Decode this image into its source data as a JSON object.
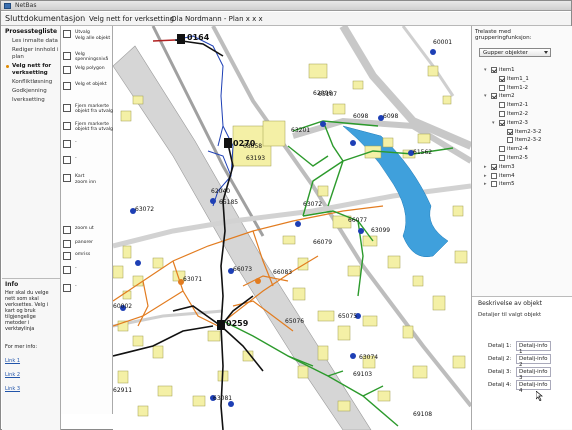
{
  "app": {
    "title": "NetBas"
  },
  "header": {
    "title": "Sluttdokumentasjon",
    "step": "Velg nett for verksetting",
    "context": "Ola Nordmann - Plan x x x"
  },
  "process": {
    "heading": "Prosesstegliste",
    "steps": [
      {
        "label": "Les inmalte data"
      },
      {
        "label": "Rediger innhold i plan"
      },
      {
        "label": "Velg nett for verksetting",
        "active": true
      },
      {
        "label": "Konfliktløsning"
      },
      {
        "label": "Godkjenning"
      },
      {
        "label": "Iverksetting"
      }
    ]
  },
  "info": {
    "heading": "Info",
    "text": "Her skal du velge nett som skal verksettes. Velg i kart og bruk tilgjengelige metoder i verktøylinja",
    "more": "For mer info:",
    "links": [
      "Link 1",
      "Link 2",
      "Link 3"
    ]
  },
  "toolbar": {
    "items": [
      {
        "label": "Utvalg",
        "sub": "Velg alle objekt"
      },
      {
        "label": "Velg spenningsnivå"
      },
      {
        "label": "Velg polygon"
      },
      {
        "label": "Velg et objekt"
      },
      {
        "label": "Fjern markerte objekt fra utvalg"
      },
      {
        "label": "Fjern markerte objekt fra utvalg"
      },
      {
        "label": "-"
      },
      {
        "label": "-"
      },
      {
        "label": "Kart",
        "sub": "zoom inn"
      },
      {
        "label": "zoom ut"
      },
      {
        "label": "panorer"
      },
      {
        "label": "omriss"
      },
      {
        "label": "-"
      },
      {
        "label": "-"
      }
    ]
  },
  "map": {
    "labels": {
      "a": "0164",
      "b": "0270",
      "c": "0259",
      "d": "6098",
      "e": "61562",
      "f": "63201",
      "g": "65107",
      "h": "60001",
      "i": "63072",
      "j": "66079",
      "k": "66077",
      "l": "66073",
      "m": "66083",
      "n": "65076",
      "o": "65075",
      "p": "63074",
      "q": "63081",
      "r": "63071",
      "s": "60002",
      "t": "62040",
      "u": "62096",
      "v": "63099",
      "w": "65185",
      "x": "63193",
      "y": "6098",
      "z": "62911",
      "aa": "68058",
      "ab": "69103",
      "ac": "63072",
      "ad": "69108"
    }
  },
  "tree": {
    "title": "Trelaste med grupperingfunksjon:",
    "select": "Gupper objekter",
    "items": [
      {
        "label": "item1",
        "depth": 0,
        "toggle": "▾",
        "checked": true
      },
      {
        "label": "Item1_1",
        "depth": 1,
        "checked": true
      },
      {
        "label": "Item1-2",
        "depth": 1,
        "checked": false
      },
      {
        "label": "item2",
        "depth": 0,
        "toggle": "▾",
        "checked": true
      },
      {
        "label": "Item2-1",
        "depth": 1,
        "checked": false
      },
      {
        "label": "Item2-2",
        "depth": 1,
        "checked": false
      },
      {
        "label": "item2-3",
        "depth": 1,
        "toggle": "▾",
        "checked": true
      },
      {
        "label": "Item2-3-2",
        "depth": 2,
        "checked": true
      },
      {
        "label": "Item2-3-2",
        "depth": 2,
        "checked": false
      },
      {
        "label": "item2-4",
        "depth": 1,
        "checked": false
      },
      {
        "label": "item2-5",
        "depth": 1,
        "checked": false
      },
      {
        "label": "item3",
        "depth": 0,
        "toggle": "▸",
        "checked": true
      },
      {
        "label": "item4",
        "depth": 0,
        "toggle": "▸",
        "checked": false
      },
      {
        "label": "item5",
        "depth": 0,
        "toggle": "▸",
        "checked": false
      }
    ]
  },
  "description": {
    "title": "Beskrivelse av objekt",
    "subtitle": "Detaljer til valgt objekt",
    "details": [
      {
        "label": "Detalj 1:",
        "value": "Detalj-info 1"
      },
      {
        "label": "Detalj 2:",
        "value": "Detalj-info 2"
      },
      {
        "label": "Detalj 3:",
        "value": "Detalj-info 3"
      },
      {
        "label": "Detalj 4:",
        "value": "Detalj-info 4"
      }
    ]
  }
}
